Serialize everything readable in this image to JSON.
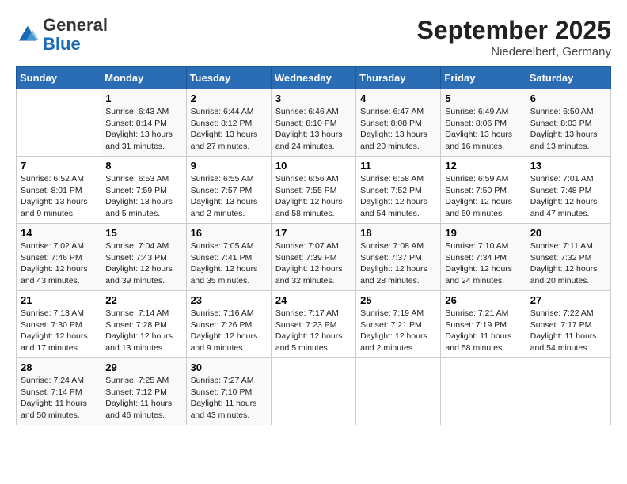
{
  "header": {
    "logo": {
      "general": "General",
      "blue": "Blue"
    },
    "title": "September 2025",
    "location": "Niederelbert, Germany"
  },
  "days_of_week": [
    "Sunday",
    "Monday",
    "Tuesday",
    "Wednesday",
    "Thursday",
    "Friday",
    "Saturday"
  ],
  "weeks": [
    [
      {
        "day": "",
        "info": ""
      },
      {
        "day": "1",
        "info": "Sunrise: 6:43 AM\nSunset: 8:14 PM\nDaylight: 13 hours\nand 31 minutes."
      },
      {
        "day": "2",
        "info": "Sunrise: 6:44 AM\nSunset: 8:12 PM\nDaylight: 13 hours\nand 27 minutes."
      },
      {
        "day": "3",
        "info": "Sunrise: 6:46 AM\nSunset: 8:10 PM\nDaylight: 13 hours\nand 24 minutes."
      },
      {
        "day": "4",
        "info": "Sunrise: 6:47 AM\nSunset: 8:08 PM\nDaylight: 13 hours\nand 20 minutes."
      },
      {
        "day": "5",
        "info": "Sunrise: 6:49 AM\nSunset: 8:06 PM\nDaylight: 13 hours\nand 16 minutes."
      },
      {
        "day": "6",
        "info": "Sunrise: 6:50 AM\nSunset: 8:03 PM\nDaylight: 13 hours\nand 13 minutes."
      }
    ],
    [
      {
        "day": "7",
        "info": "Sunrise: 6:52 AM\nSunset: 8:01 PM\nDaylight: 13 hours\nand 9 minutes."
      },
      {
        "day": "8",
        "info": "Sunrise: 6:53 AM\nSunset: 7:59 PM\nDaylight: 13 hours\nand 5 minutes."
      },
      {
        "day": "9",
        "info": "Sunrise: 6:55 AM\nSunset: 7:57 PM\nDaylight: 13 hours\nand 2 minutes."
      },
      {
        "day": "10",
        "info": "Sunrise: 6:56 AM\nSunset: 7:55 PM\nDaylight: 12 hours\nand 58 minutes."
      },
      {
        "day": "11",
        "info": "Sunrise: 6:58 AM\nSunset: 7:52 PM\nDaylight: 12 hours\nand 54 minutes."
      },
      {
        "day": "12",
        "info": "Sunrise: 6:59 AM\nSunset: 7:50 PM\nDaylight: 12 hours\nand 50 minutes."
      },
      {
        "day": "13",
        "info": "Sunrise: 7:01 AM\nSunset: 7:48 PM\nDaylight: 12 hours\nand 47 minutes."
      }
    ],
    [
      {
        "day": "14",
        "info": "Sunrise: 7:02 AM\nSunset: 7:46 PM\nDaylight: 12 hours\nand 43 minutes."
      },
      {
        "day": "15",
        "info": "Sunrise: 7:04 AM\nSunset: 7:43 PM\nDaylight: 12 hours\nand 39 minutes."
      },
      {
        "day": "16",
        "info": "Sunrise: 7:05 AM\nSunset: 7:41 PM\nDaylight: 12 hours\nand 35 minutes."
      },
      {
        "day": "17",
        "info": "Sunrise: 7:07 AM\nSunset: 7:39 PM\nDaylight: 12 hours\nand 32 minutes."
      },
      {
        "day": "18",
        "info": "Sunrise: 7:08 AM\nSunset: 7:37 PM\nDaylight: 12 hours\nand 28 minutes."
      },
      {
        "day": "19",
        "info": "Sunrise: 7:10 AM\nSunset: 7:34 PM\nDaylight: 12 hours\nand 24 minutes."
      },
      {
        "day": "20",
        "info": "Sunrise: 7:11 AM\nSunset: 7:32 PM\nDaylight: 12 hours\nand 20 minutes."
      }
    ],
    [
      {
        "day": "21",
        "info": "Sunrise: 7:13 AM\nSunset: 7:30 PM\nDaylight: 12 hours\nand 17 minutes."
      },
      {
        "day": "22",
        "info": "Sunrise: 7:14 AM\nSunset: 7:28 PM\nDaylight: 12 hours\nand 13 minutes."
      },
      {
        "day": "23",
        "info": "Sunrise: 7:16 AM\nSunset: 7:26 PM\nDaylight: 12 hours\nand 9 minutes."
      },
      {
        "day": "24",
        "info": "Sunrise: 7:17 AM\nSunset: 7:23 PM\nDaylight: 12 hours\nand 5 minutes."
      },
      {
        "day": "25",
        "info": "Sunrise: 7:19 AM\nSunset: 7:21 PM\nDaylight: 12 hours\nand 2 minutes."
      },
      {
        "day": "26",
        "info": "Sunrise: 7:21 AM\nSunset: 7:19 PM\nDaylight: 11 hours\nand 58 minutes."
      },
      {
        "day": "27",
        "info": "Sunrise: 7:22 AM\nSunset: 7:17 PM\nDaylight: 11 hours\nand 54 minutes."
      }
    ],
    [
      {
        "day": "28",
        "info": "Sunrise: 7:24 AM\nSunset: 7:14 PM\nDaylight: 11 hours\nand 50 minutes."
      },
      {
        "day": "29",
        "info": "Sunrise: 7:25 AM\nSunset: 7:12 PM\nDaylight: 11 hours\nand 46 minutes."
      },
      {
        "day": "30",
        "info": "Sunrise: 7:27 AM\nSunset: 7:10 PM\nDaylight: 11 hours\nand 43 minutes."
      },
      {
        "day": "",
        "info": ""
      },
      {
        "day": "",
        "info": ""
      },
      {
        "day": "",
        "info": ""
      },
      {
        "day": "",
        "info": ""
      }
    ]
  ]
}
